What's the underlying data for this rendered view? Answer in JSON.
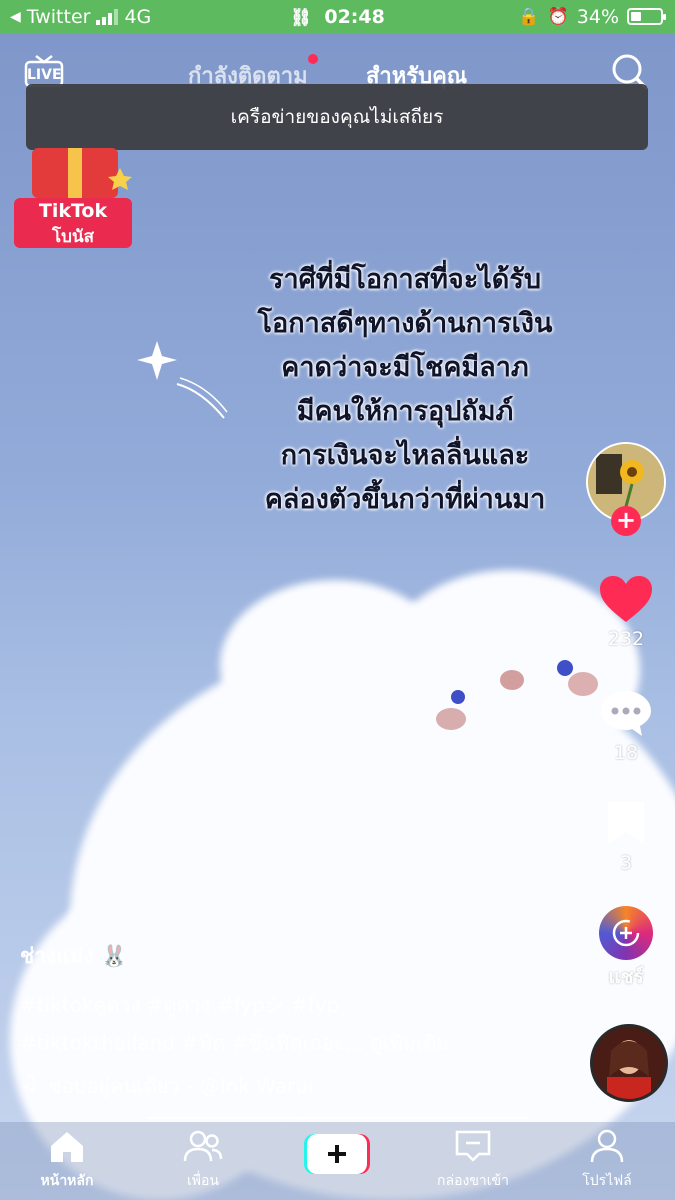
{
  "status_bar": {
    "back_app": "Twitter",
    "network": "4G",
    "time": "02:48",
    "battery": "34%",
    "battery_level": 0.34
  },
  "top_nav": {
    "live_label": "LIVE",
    "following_tab": "กำลังติดตาม",
    "for_you_tab": "สำหรับคุณ"
  },
  "toast": {
    "message": "เครือข่ายของคุณไม่เสถียร"
  },
  "bonus_badge": {
    "line1": "TikTok",
    "line2": "โบนัส"
  },
  "video_caption": {
    "lines": [
      "ราศีที่มีโอกาสที่จะได้รับ",
      "โอกาสดีๆทางด้านการเงิน",
      "คาดว่าจะมีโชคมีลาภ",
      "มีคนให้การอุปถัมภ์",
      "การเงินจะไหลลื่นและ",
      "คล่องตัวขึ้นกว่าที่ผ่านมา"
    ]
  },
  "actions": {
    "likes": "232",
    "comments": "18",
    "saves": "3",
    "share_label": "แชร์"
  },
  "post": {
    "author": "ช่างแม่ง 🐰",
    "hashtags_line1": "#tiktokดูดวง #ดูดวง #fypシ #fyp",
    "hashtags_line2": "#tiktokthailand #ฟีด #ขึ้นฟีดเถอะ... ดูเพิ่มเติม",
    "sound": "ชอบอยู่คนเดียว - @Ink Waruı"
  },
  "bottom_nav": {
    "home": "หน้าหลัก",
    "friends": "เพื่อน",
    "inbox": "กล่องขาเข้า",
    "profile": "โปรไฟล์"
  },
  "colors": {
    "status_bar": "#5dba5f",
    "accent": "#fe2c55"
  }
}
